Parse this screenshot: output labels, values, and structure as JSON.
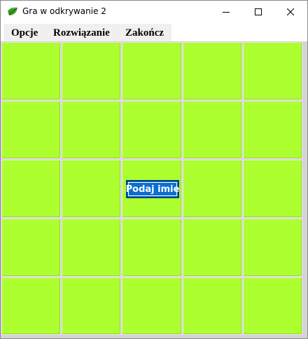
{
  "window": {
    "title": "Gra w odkrywanie 2",
    "icon": "leaf-icon",
    "controls": [
      "minimize-icon",
      "maximize-icon",
      "close-icon"
    ]
  },
  "menu": {
    "items": [
      {
        "label": "Opcje"
      },
      {
        "label": "Rozwiązanie"
      },
      {
        "label": "Zakończ"
      }
    ]
  },
  "board": {
    "rows": 5,
    "cols": 5,
    "tile_color": "#adff2f",
    "name_button": "Podaj imie"
  },
  "colors": {
    "tile": "#adff2f",
    "button": "#0a6fd1"
  }
}
